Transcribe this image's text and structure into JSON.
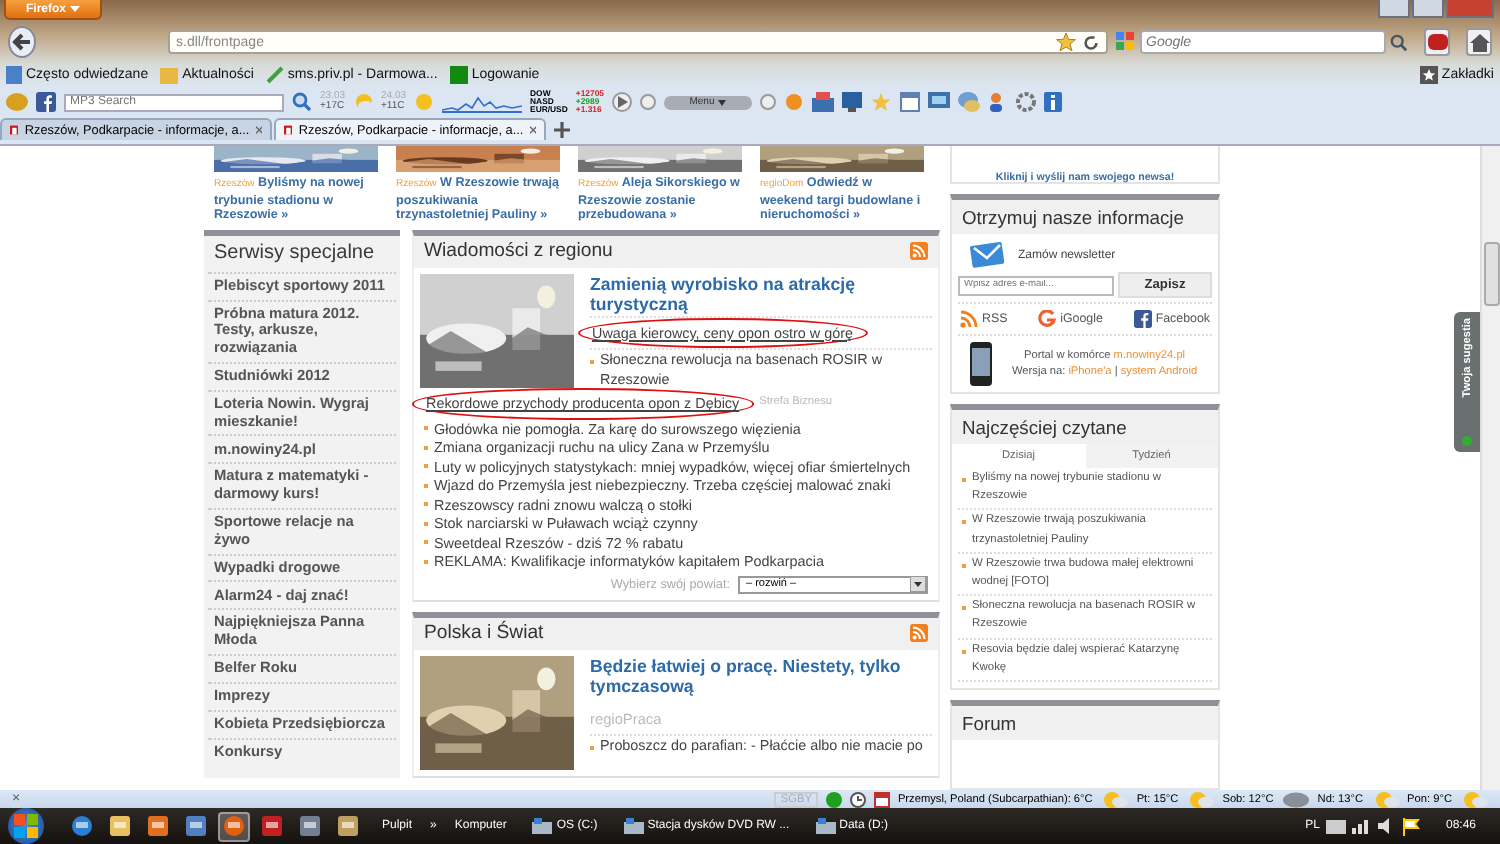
{
  "browser": {
    "menu_button": "Firefox",
    "url": "s.dll/frontpage",
    "search": {
      "placeholder": "Google"
    }
  },
  "bookmarks": [
    {
      "label": "Często odwiedzane",
      "kind": "page"
    },
    {
      "label": "Aktualności",
      "kind": "feed"
    },
    {
      "label": "sms.priv.pl - Darmowa...",
      "kind": "link"
    },
    {
      "label": "Logowanie",
      "kind": "square"
    }
  ],
  "bookmarks_menu": "Zakładki",
  "toolbar": {
    "search": {
      "placeholder": "MP3 Search"
    },
    "weather": [
      {
        "date": "23.03",
        "temp": "+17C"
      },
      {
        "date": "24.03",
        "temp": "+11C"
      }
    ],
    "markets": [
      "DOW",
      "NASD",
      "EUR/USD"
    ],
    "quotes": [
      {
        "value": "+12705",
        "color": "#d42020"
      },
      {
        "value": "+2989",
        "color": "#20a020"
      },
      {
        "value": "+1.316",
        "color": "#d42020"
      }
    ],
    "player": "Menu"
  },
  "tabs": [
    {
      "label": "Rzeszów, Podkarpacie - informacje, a...",
      "selected": false
    },
    {
      "label": "Rzeszów, Podkarpacie - informacje, a...",
      "selected": true
    }
  ],
  "teasers": [
    {
      "source": "Rzeszów",
      "title": "Byliśmy na nowej trybunie stadionu w Rzeszowie »"
    },
    {
      "source": "Rzeszów",
      "title": "W Rzeszowie trwają poszukiwania trzynastoletniej Pauliny »"
    },
    {
      "source": "Rzeszów",
      "title": "Aleja Sikorskiego w Rzeszowie zostanie przebudowana »"
    },
    {
      "source": "regioDom",
      "title": "Odwiedź w weekend targi budowlane i nieruchomości »"
    }
  ],
  "sidebar": {
    "title": "Serwisy specjalne",
    "items": [
      "Plebiscyt sportowy 2011",
      "Próbna matura 2012. Testy, arkusze, rozwiązania",
      "Studniówki 2012",
      "Loteria Nowin. Wygraj mieszkanie!",
      "m.nowiny24.pl",
      "Matura z matematyki - darmowy kurs!",
      "Sportowe relacje na żywo",
      "Wypadki drogowe",
      "Alarm24 - daj znać!",
      "Najpiękniejsza Panna Młoda",
      "Belfer Roku",
      "Imprezy",
      "Kobieta Przedsiębiorcza",
      "Konkursy"
    ]
  },
  "regional": {
    "title": "Wiadomości z regionu",
    "headline": "Zamienią wyrobisko na atrakcję turystyczną",
    "lead_items": [
      {
        "text": "Uwaga kierowcy, ceny opon ostro w górę",
        "circled": true
      },
      {
        "text": "Słoneczna rewolucja na basenach ROSIR w Rzeszowie",
        "circled": false
      }
    ],
    "items": [
      {
        "text": "Rekordowe przychody producenta opon z Dębicy",
        "circled": true,
        "tag": "Strefa Biznesu"
      },
      {
        "text": "Głodówka nie pomogła. Za karę do surowszego więzienia",
        "circled": false
      },
      {
        "text": "Zmiana organizacji ruchu na ulicy Zana w Przemyślu",
        "circled": false
      },
      {
        "text": "Luty w policyjnych statystykach: mniej wypadków, więcej ofiar śmiertelnych",
        "circled": false
      },
      {
        "text": "Wjazd do Przemyśla jest niebezpieczny. Trzeba częściej malować znaki",
        "circled": false
      },
      {
        "text": "Rzeszowscy radni znowu walczą o stołki",
        "circled": false
      },
      {
        "text": "Stok narciarski w Puławach wciąż czynny",
        "circled": false
      },
      {
        "text": "Sweetdeal Rzeszów - dziś 72 % rabatu",
        "circled": false
      },
      {
        "text": "REKLAMA: Kwalifikacje informatyków kapitałem Podkarpacia",
        "circled": false
      }
    ],
    "district": {
      "label": "Wybierz swój powiat:",
      "value": "– rozwiń –"
    }
  },
  "world": {
    "title": "Polska i Świat",
    "headline": "Będzie łatwiej o pracę. Niestety, tylko tymczasową",
    "tag": "regioPraca",
    "items": [
      "Proboszcz do parafian: - Płaćcie albo nie macie po"
    ]
  },
  "right": {
    "send_news": "Kliknij i wyślij nam swojego newsa!",
    "newsletter": {
      "title": "Otrzymuj nasze informacje",
      "link": "Zamów newsletter",
      "email_placeholder": "Wpisz adres e-mail...",
      "button": "Zapisz"
    },
    "feeds": [
      {
        "label": "RSS",
        "kind": "rss"
      },
      {
        "label": "iGoogle",
        "kind": "google"
      },
      {
        "label": "Facebook",
        "kind": "facebook"
      }
    ],
    "mobile": {
      "text": "Portal w komórce",
      "link": "m.nowiny24.pl",
      "versions_label": "Wersja na:",
      "versions": [
        "iPhone'a",
        "system Android"
      ],
      "separator": "|"
    },
    "popular": {
      "title": "Najczęściej czytane",
      "tabs": [
        {
          "label": "Dzisiaj",
          "selected": true
        },
        {
          "label": "Tydzień",
          "selected": false
        }
      ],
      "items": [
        "Byliśmy na nowej trybunie stadionu w Rzeszowie",
        "W Rzeszowie trwają poszukiwania trzynastoletniej Pauliny",
        "W Rzeszowie trwa budowa małej elektrowni wodnej [FOTO]",
        "Słoneczna rewolucja na basenach ROSIR w Rzeszowie",
        "Resovia będzie dalej wspierać Katarzynę Kwokę"
      ]
    },
    "forum": "Forum"
  },
  "feedback_tab": "Twoja sugestia",
  "status_bar": {
    "close": "×",
    "code": "SGBY",
    "weather": [
      {
        "label": "Przemysl, Poland (Subcarpathian): 6°C",
        "kind": "sun"
      },
      {
        "label": "Pt: 15°C",
        "kind": "sun"
      },
      {
        "label": "Sob: 12°C",
        "kind": "cloud"
      },
      {
        "label": "Nd: 13°C",
        "kind": "sun"
      },
      {
        "label": "Pon: 9°C",
        "kind": "sun"
      }
    ]
  },
  "taskbar": {
    "apps": [
      {
        "kind": "globe",
        "active": false
      },
      {
        "kind": "folder",
        "active": false
      },
      {
        "kind": "media",
        "active": false
      },
      {
        "kind": "disk",
        "active": false
      },
      {
        "kind": "fox",
        "active": true
      },
      {
        "kind": "document",
        "active": false
      },
      {
        "kind": "calculator",
        "active": false
      },
      {
        "kind": "tool",
        "active": false
      }
    ],
    "toolbar": [
      "Pulpit",
      "»",
      "Komputer"
    ],
    "drives": [
      "OS (C:)",
      "Stacja dysków DVD RW ...",
      "Data (D:)"
    ],
    "language": "PL",
    "clock": "08:46"
  }
}
